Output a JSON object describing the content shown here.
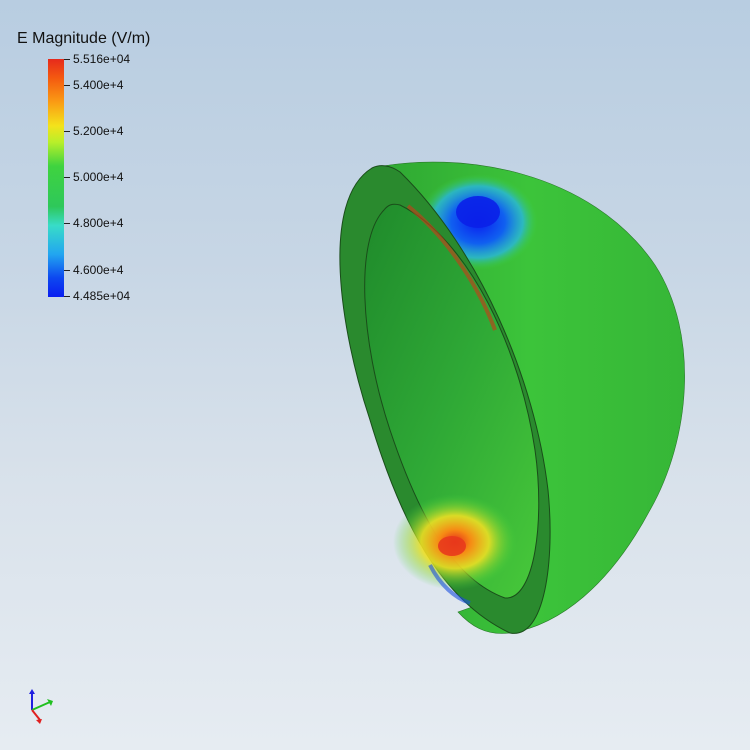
{
  "legend": {
    "title": "E Magnitude (V/m)",
    "ticks": [
      {
        "label": "5.516e+04"
      },
      {
        "label": "5.400e+4"
      },
      {
        "label": "5.200e+4"
      },
      {
        "label": "5.000e+4"
      },
      {
        "label": "4.800e+4"
      },
      {
        "label": "4.600e+4"
      },
      {
        "label": "4.485e+04"
      }
    ],
    "colors": [
      "#e62a1c",
      "#f4e21b",
      "#2ec85a",
      "#38dcc8",
      "#0a1ef0"
    ]
  },
  "scene": {
    "object": "hemispherical-shell",
    "background_top": "#b8cde1",
    "background_bottom": "#e6ecf2"
  },
  "orientation_axes": {
    "x_color": "#e02020",
    "y_color": "#20c020",
    "z_color": "#2020e0"
  }
}
